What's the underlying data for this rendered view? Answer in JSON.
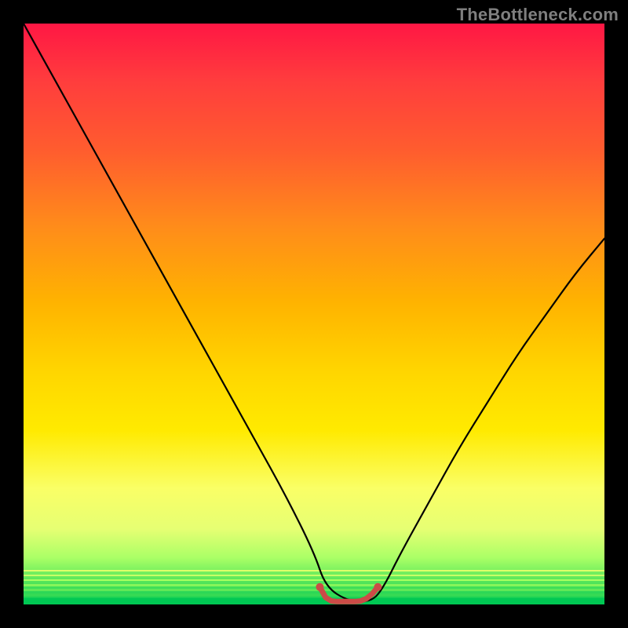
{
  "watermark": {
    "text": "TheBottleneck.com"
  },
  "chart_data": {
    "type": "line",
    "title": "",
    "xlabel": "",
    "ylabel": "",
    "xlim": [
      0,
      100
    ],
    "ylim": [
      0,
      100
    ],
    "grid": false,
    "legend": false,
    "series": [
      {
        "name": "bottleneck-curve",
        "color": "#000000",
        "x": [
          0,
          5,
          10,
          15,
          20,
          25,
          30,
          35,
          40,
          45,
          50,
          52,
          56,
          60,
          62,
          65,
          70,
          75,
          80,
          85,
          90,
          95,
          100
        ],
        "y": [
          100,
          91,
          82,
          73,
          64,
          55,
          46,
          37,
          28,
          19,
          9,
          3,
          0.5,
          0.5,
          3,
          9,
          18,
          27,
          35,
          43,
          50,
          57,
          63
        ]
      },
      {
        "name": "optimal-marker",
        "color": "#d9534f",
        "x": [
          51,
          52,
          53,
          54,
          55,
          56,
          57,
          58,
          59,
          60,
          61
        ],
        "y": [
          3,
          1.2,
          0.6,
          0.5,
          0.5,
          0.5,
          0.5,
          0.6,
          1.0,
          1.8,
          3
        ]
      }
    ],
    "gradient_bands": [
      {
        "pos": 0.0,
        "color": "#ff1744"
      },
      {
        "pos": 0.5,
        "color": "#ffd600"
      },
      {
        "pos": 0.9,
        "color": "#aaff66"
      },
      {
        "pos": 1.0,
        "color": "#00c853"
      }
    ]
  }
}
